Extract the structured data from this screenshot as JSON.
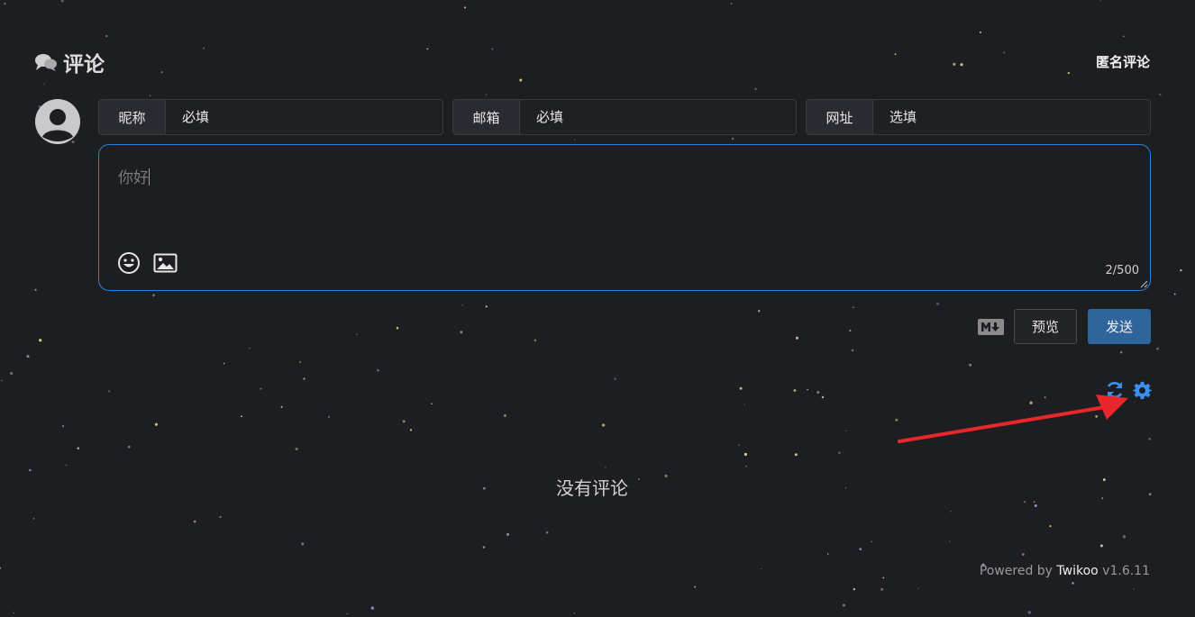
{
  "header": {
    "title": "评论",
    "title_icon": "comments-icon",
    "anonymous_label": "匿名评论"
  },
  "avatar": {
    "icon": "user-avatar-icon"
  },
  "fields": [
    {
      "label": "昵称",
      "placeholder": "必填"
    },
    {
      "label": "邮箱",
      "placeholder": "必填"
    },
    {
      "label": "网址",
      "placeholder": "选填"
    }
  ],
  "editor": {
    "value": "你好",
    "counter": "2/500",
    "icons": [
      "emoji-icon",
      "image-icon"
    ]
  },
  "actions": {
    "markdown_icon": "markdown-icon",
    "preview_label": "预览",
    "send_label": "发送"
  },
  "tools": {
    "refresh_icon": "refresh-icon",
    "settings_icon": "gear-icon"
  },
  "annotation": {
    "arrow_color": "#e8262b"
  },
  "empty_text": "没有评论",
  "footer": {
    "powered_prefix": "Powered by ",
    "brand": "Twikoo",
    "version": " v1.6.11"
  },
  "colors": {
    "background": "#1d1e22",
    "accent_border": "#2f7fd6",
    "send_button": "#30659c",
    "tool_icons": "#3b8ff0"
  }
}
